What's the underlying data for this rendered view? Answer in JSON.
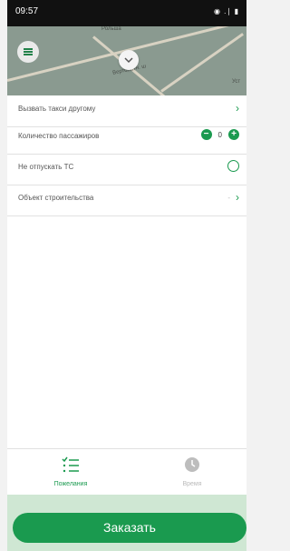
{
  "status": {
    "time": "09:57",
    "icons": "◉ .∣ ▮"
  },
  "map": {
    "street_label": "Вертолётн. ш",
    "street_label_2": "Рольша",
    "street_label_3": "Уст"
  },
  "options": [
    {
      "label": "Вызвать такси другому"
    },
    {
      "label": "Количество пассажиров",
      "count": "0",
      "minus": "−",
      "plus": "+"
    },
    {
      "label": "Не отпускать ТС"
    },
    {
      "label": "Объект строительства",
      "value": "-"
    }
  ],
  "chevron": "›",
  "tabs": [
    {
      "label": "Пожелания",
      "active": true,
      "icon": "checklist-icon"
    },
    {
      "label": "Время",
      "active": false,
      "icon": "clock-icon"
    }
  ],
  "order_button": "Заказать",
  "colors": {
    "accent": "#1a9a4f",
    "bottom_bg": "#cfe7d3"
  }
}
